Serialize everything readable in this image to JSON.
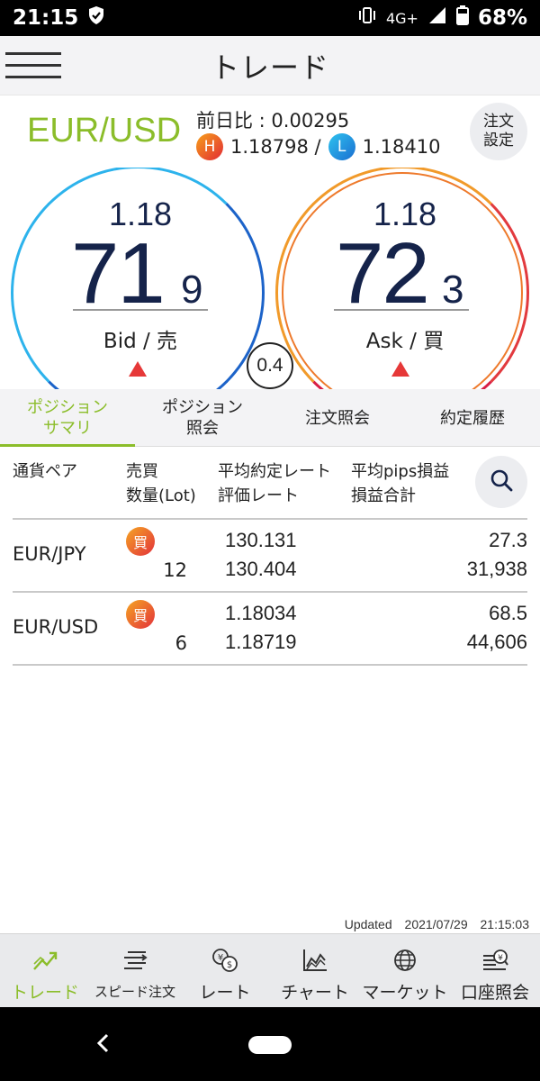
{
  "status_bar": {
    "time": "21:15",
    "network": "4G+",
    "battery": "68%"
  },
  "app_bar": {
    "title": "トレード"
  },
  "pair_info": {
    "pair": "EUR/USD",
    "change": "前日比 : 0.00295",
    "high_badge": "H",
    "high": "1.18798 /",
    "low_badge": "L",
    "low": "1.18410",
    "order_settings": "注文\n設定"
  },
  "quotes": {
    "bid": {
      "prefix": "1.18",
      "big": "71",
      "small": "9",
      "label": "Bid / 売"
    },
    "ask": {
      "prefix": "1.18",
      "big": "72",
      "small": "3",
      "label": "Ask / 買"
    },
    "spread": "0.4"
  },
  "tabs": [
    {
      "label": "ポジション\nサマリ",
      "active": true
    },
    {
      "label": "ポジション\n照会",
      "active": false
    },
    {
      "label": "注文照会",
      "active": false
    },
    {
      "label": "約定履歴",
      "active": false
    }
  ],
  "table": {
    "headers": {
      "pair": "通貨ペア",
      "side_qty": "売買\n数量(Lot)",
      "rates": "平均約定レート\n評価レート",
      "pl": "平均pips損益\n損益合計"
    },
    "rows": [
      {
        "pair": "EUR/JPY",
        "side": "買",
        "lot": "12",
        "avg_rate": "130.131",
        "eval_rate": "130.404",
        "pips": "27.3",
        "pl_total": "31,938"
      },
      {
        "pair": "EUR/USD",
        "side": "買",
        "lot": "6",
        "avg_rate": "1.18034",
        "eval_rate": "1.18719",
        "pips": "68.5",
        "pl_total": "44,606"
      }
    ]
  },
  "updated": {
    "label": "Updated",
    "date": "2021/07/29",
    "time": "21:15:03"
  },
  "bottom_nav": [
    {
      "label": "トレード",
      "icon": "trend-icon",
      "active": true
    },
    {
      "label": "スピード注文",
      "icon": "speed-order-icon",
      "active": false
    },
    {
      "label": "レート",
      "icon": "rate-icon",
      "active": false
    },
    {
      "label": "チャート",
      "icon": "chart-icon",
      "active": false
    },
    {
      "label": "マーケット",
      "icon": "globe-icon",
      "active": false
    },
    {
      "label": "口座照会",
      "icon": "account-icon",
      "active": false
    }
  ],
  "colors": {
    "accent_green": "#8bbd2a",
    "bid_blue": "#1c63c9",
    "ask_red": "#e23a3e",
    "text_navy": "#15234a"
  }
}
